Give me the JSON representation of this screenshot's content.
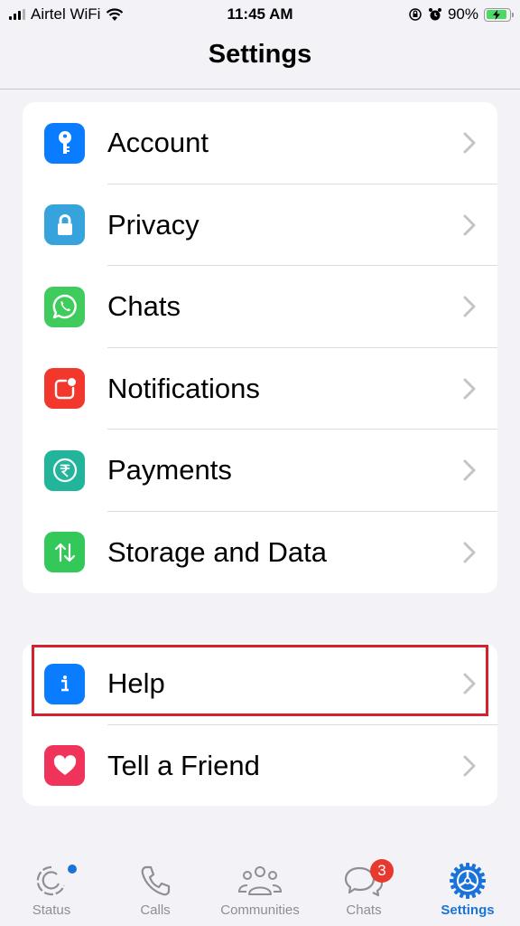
{
  "status_bar": {
    "carrier": "Airtel WiFi",
    "time": "11:45 AM",
    "battery": "90%"
  },
  "header": {
    "title": "Settings"
  },
  "groups": [
    {
      "items": [
        {
          "label": "Account",
          "icon": "key-icon",
          "color": "#0a7cff"
        },
        {
          "label": "Privacy",
          "icon": "lock-icon",
          "color": "#36a3dd"
        },
        {
          "label": "Chats",
          "icon": "whatsapp-icon",
          "color": "#3fcc5c"
        },
        {
          "label": "Notifications",
          "icon": "notification-icon",
          "color": "#f2382d"
        },
        {
          "label": "Payments",
          "icon": "rupee-icon",
          "color": "#22b59c"
        },
        {
          "label": "Storage and Data",
          "icon": "arrows-up-down-icon",
          "color": "#34c759"
        }
      ]
    },
    {
      "items": [
        {
          "label": "Help",
          "icon": "info-icon",
          "color": "#0a7cff",
          "highlighted": true
        },
        {
          "label": "Tell a Friend",
          "icon": "heart-icon",
          "color": "#f0335a"
        }
      ]
    }
  ],
  "tabbar": {
    "tabs": [
      {
        "label": "Status",
        "icon": "status-icon",
        "active": false
      },
      {
        "label": "Calls",
        "icon": "phone-icon",
        "active": false
      },
      {
        "label": "Communities",
        "icon": "communities-icon",
        "active": false
      },
      {
        "label": "Chats",
        "icon": "chats-icon",
        "active": false,
        "badge": "3"
      },
      {
        "label": "Settings",
        "icon": "settings-gear-icon",
        "active": true
      }
    ]
  },
  "colors": {
    "accent": "#1a73d9",
    "highlight_border": "#d8202c",
    "badge": "#e8392f"
  }
}
